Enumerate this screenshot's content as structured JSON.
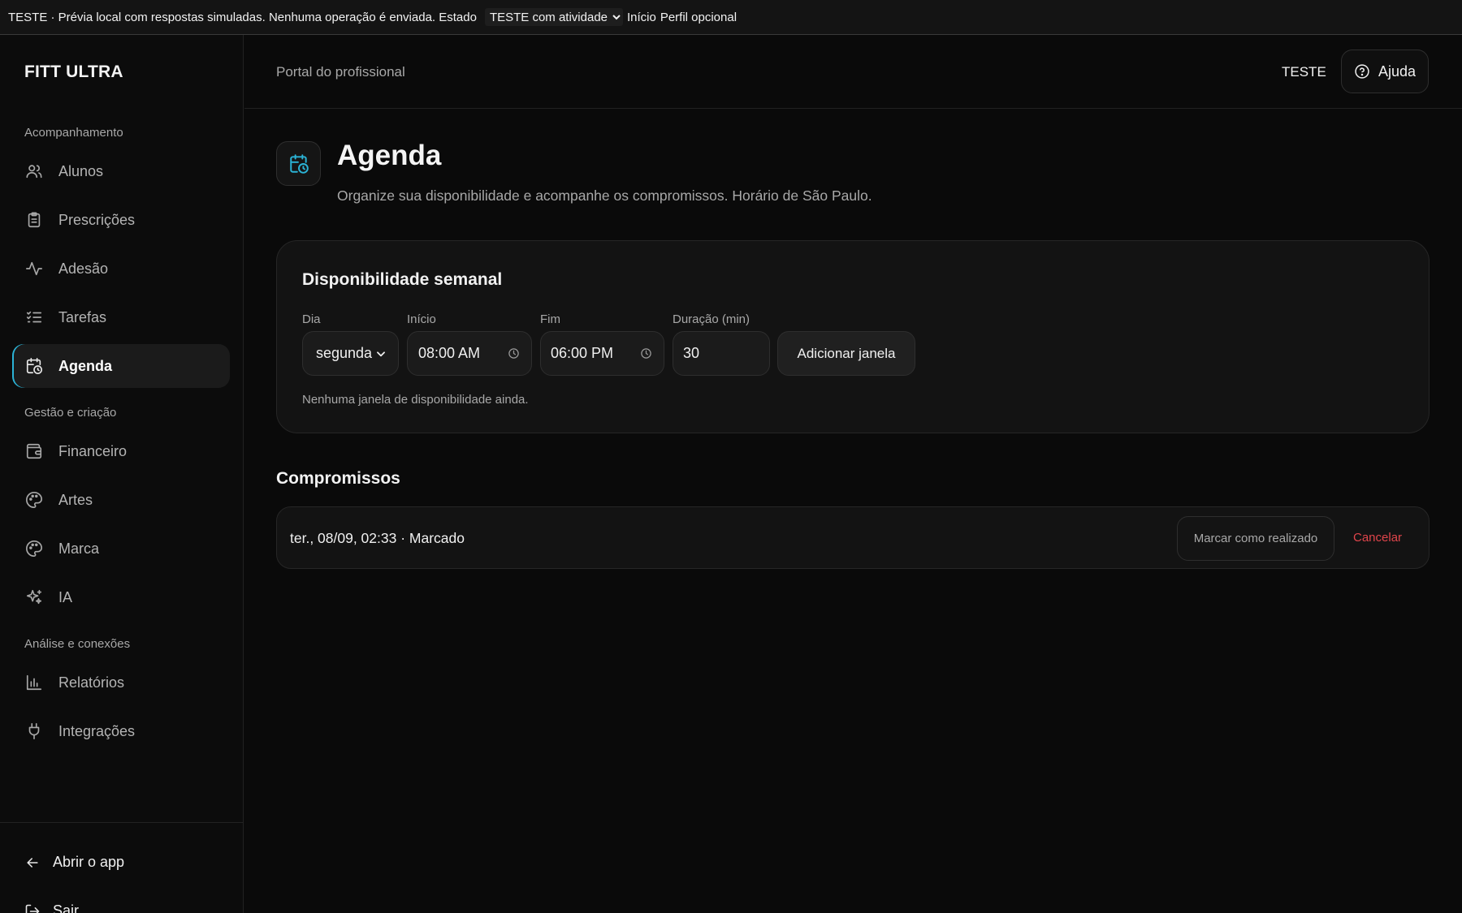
{
  "banner": {
    "text": "TESTE · Prévia local com respostas simuladas. Nenhuma operação é enviada. Estado",
    "state_selected": "TESTE com atividade",
    "link_inicio": "Início",
    "link_perfil": "Perfil opcional"
  },
  "sidebar": {
    "brand": "FITT ULTRA",
    "sections": [
      {
        "label": "Acompanhamento"
      },
      {
        "label": "Gestão e criação"
      },
      {
        "label": "Análise e conexões"
      }
    ],
    "items": [
      {
        "label": "Alunos",
        "icon": "users-icon"
      },
      {
        "label": "Prescrições",
        "icon": "clipboard-icon"
      },
      {
        "label": "Adesão",
        "icon": "activity-icon"
      },
      {
        "label": "Tarefas",
        "icon": "list-checks-icon"
      },
      {
        "label": "Agenda",
        "icon": "calendar-clock-icon",
        "active": true
      },
      {
        "label": "Financeiro",
        "icon": "wallet-icon"
      },
      {
        "label": "Artes",
        "icon": "palette-icon"
      },
      {
        "label": "Marca",
        "icon": "palette-icon"
      },
      {
        "label": "IA",
        "icon": "sparkles-icon"
      },
      {
        "label": "Relatórios",
        "icon": "bar-chart-icon"
      },
      {
        "label": "Integrações",
        "icon": "plug-icon"
      }
    ],
    "bottom": {
      "open_app": "Abrir o app",
      "logout": "Sair"
    }
  },
  "header": {
    "portal_title": "Portal do profissional",
    "test_label": "TESTE",
    "help_label": "Ajuda"
  },
  "page": {
    "title": "Agenda",
    "subtitle": "Organize sua disponibilidade e acompanhe os compromissos. Horário de São Paulo."
  },
  "availability": {
    "title": "Disponibilidade semanal",
    "day_label": "Dia",
    "day_value": "segunda",
    "start_label": "Início",
    "start_value": "08:00 AM",
    "end_label": "Fim",
    "end_value": "06:00 PM",
    "duration_label": "Duração (min)",
    "duration_value": "30",
    "add_button": "Adicionar janela",
    "empty_note": "Nenhuma janela de disponibilidade ainda."
  },
  "appointments": {
    "title": "Compromissos",
    "items": [
      {
        "text": "ter., 08/09, 02:33 · Marcado",
        "done_label": "Marcar como realizado",
        "cancel_label": "Cancelar"
      }
    ]
  },
  "colors": {
    "accent": "#2bb3d6",
    "danger": "#e0454b",
    "background": "#0a0a0a",
    "card": "#131313"
  }
}
